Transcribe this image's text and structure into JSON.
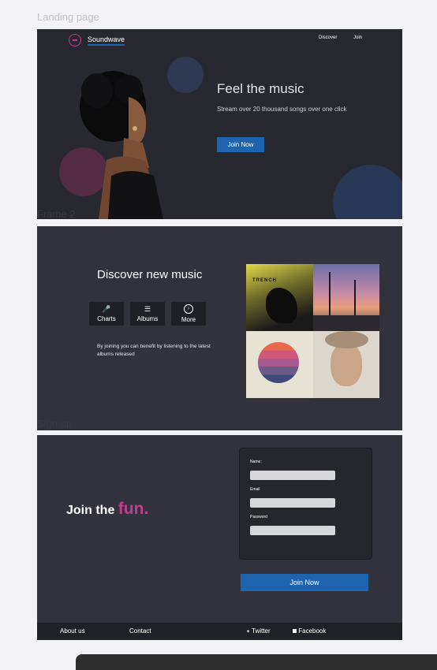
{
  "frames": {
    "landing_label": "Landing page",
    "frame2_label": "Frame 2",
    "signup_label": "Sign up"
  },
  "landing": {
    "brand": "Soundwave",
    "nav": [
      "Discover",
      "Join"
    ],
    "hero_title": "Feel the music",
    "hero_subtitle": "Stream over 20 thousand songs over one click",
    "cta": "Join Now"
  },
  "discover": {
    "title": "Discover new music",
    "categories": [
      {
        "label": "Charts",
        "icon": "microphone-icon"
      },
      {
        "label": "Albums",
        "icon": "layers-icon"
      },
      {
        "label": "More",
        "icon": "chevron-right-circle-icon"
      }
    ],
    "description": "By joining you can benefit by listening to the latest albums released",
    "album_caption": "TRENCH"
  },
  "signup": {
    "heading_prefix": "Join the",
    "heading_accent": "fun.",
    "fields": [
      {
        "label": "Name:"
      },
      {
        "label": "Email"
      },
      {
        "label": "Password"
      }
    ],
    "submit": "Join Now"
  },
  "footer": {
    "about": "About  us",
    "contact": "Contact",
    "twitter": "Twitter",
    "facebook": "Facebook"
  },
  "colors": {
    "accent_blue": "#1e63ad",
    "accent_pink": "#c13d8e",
    "dark_bg": "#282830",
    "panel_bg": "#32323d"
  }
}
